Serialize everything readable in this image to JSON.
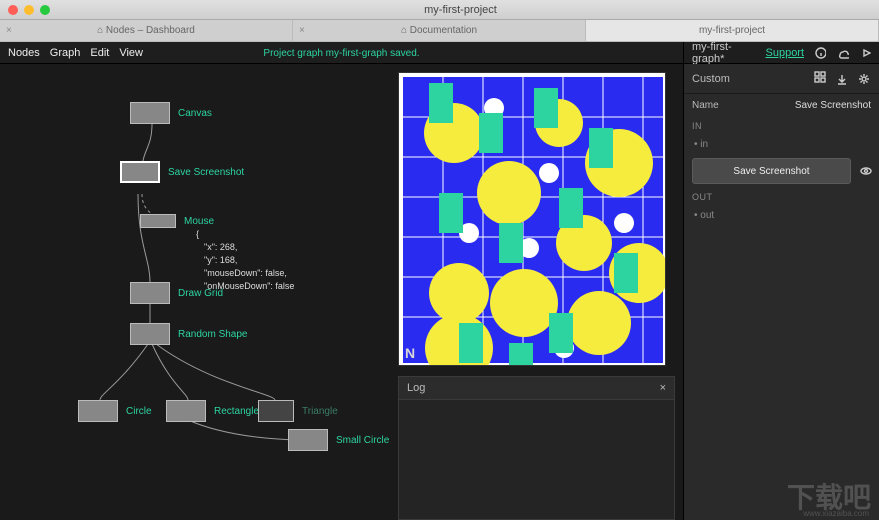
{
  "window": {
    "title": "my-first-project",
    "tabs": [
      {
        "label": "⌂ Nodes – Dashboard",
        "active": false
      },
      {
        "label": "⌂ Documentation",
        "active": false
      },
      {
        "label": "my-first-project",
        "active": true
      }
    ]
  },
  "menu": {
    "items": [
      "Nodes",
      "Graph",
      "Edit",
      "View"
    ],
    "status": "Project graph my-first-graph saved.",
    "graph_name": "my-first-graph*",
    "support": "Support"
  },
  "graph_nodes": {
    "canvas": "Canvas",
    "save_screenshot": "Save Screenshot",
    "mouse": "Mouse",
    "draw_grid": "Draw Grid",
    "random_shape": "Random Shape",
    "circle": "Circle",
    "rectangle": "Rectangle",
    "triangle": "Triangle",
    "small_circle": "Small Circle"
  },
  "mouse_data": {
    "open": "{",
    "x": "\"x\": 268,",
    "y": "\"y\": 168,",
    "md": "\"mouseDown\": false,",
    "omd": "\"onMouseDown\": false"
  },
  "log": {
    "title": "Log",
    "close": "×"
  },
  "inspector": {
    "section": "Custom",
    "name_label": "Name",
    "name_value": "Save Screenshot",
    "in_label": "IN",
    "in_port": "• in",
    "out_label": "OUT",
    "out_port": "• out",
    "button": "Save Screenshot"
  },
  "watermark": {
    "big": "下载吧",
    "url": "www.xiazaiba.com"
  }
}
